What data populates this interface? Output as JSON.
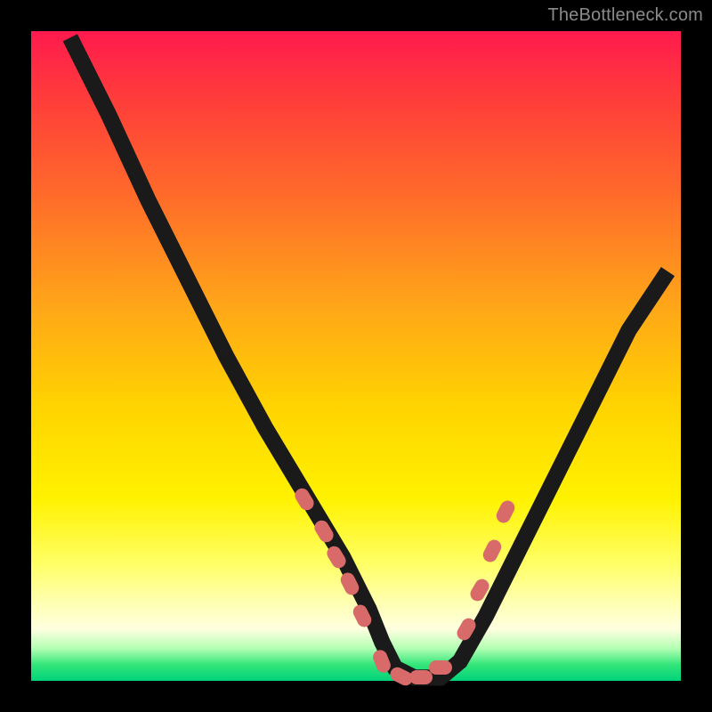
{
  "watermark": "TheBottleneck.com",
  "colors": {
    "frame": "#000000",
    "curve": "#1a1a1a",
    "marker": "#d86a6a",
    "gradient_top": "#ff1a4d",
    "gradient_bottom": "#00d27a"
  },
  "chart_data": {
    "type": "line",
    "title": "",
    "xlabel": "",
    "ylabel": "",
    "xlim": [
      0,
      100
    ],
    "ylim": [
      0,
      100
    ],
    "grid": false,
    "x": [
      6,
      12,
      18,
      24,
      30,
      36,
      42,
      48,
      52,
      54,
      56,
      59,
      63,
      66,
      70,
      74,
      80,
      86,
      92,
      98
    ],
    "y": [
      99,
      87,
      74,
      62,
      50,
      39,
      29,
      19,
      11,
      6,
      2,
      0.5,
      0.5,
      3,
      10,
      18,
      30,
      42,
      54,
      63
    ],
    "markers": [
      {
        "x": 42,
        "y": 28
      },
      {
        "x": 45,
        "y": 23
      },
      {
        "x": 47,
        "y": 19
      },
      {
        "x": 49,
        "y": 15
      },
      {
        "x": 51,
        "y": 10
      },
      {
        "x": 54,
        "y": 3
      },
      {
        "x": 57,
        "y": 0.7
      },
      {
        "x": 60,
        "y": 0.5
      },
      {
        "x": 63,
        "y": 2
      },
      {
        "x": 67,
        "y": 8
      },
      {
        "x": 69,
        "y": 14
      },
      {
        "x": 71,
        "y": 20
      },
      {
        "x": 73,
        "y": 26
      }
    ],
    "annotations": []
  }
}
